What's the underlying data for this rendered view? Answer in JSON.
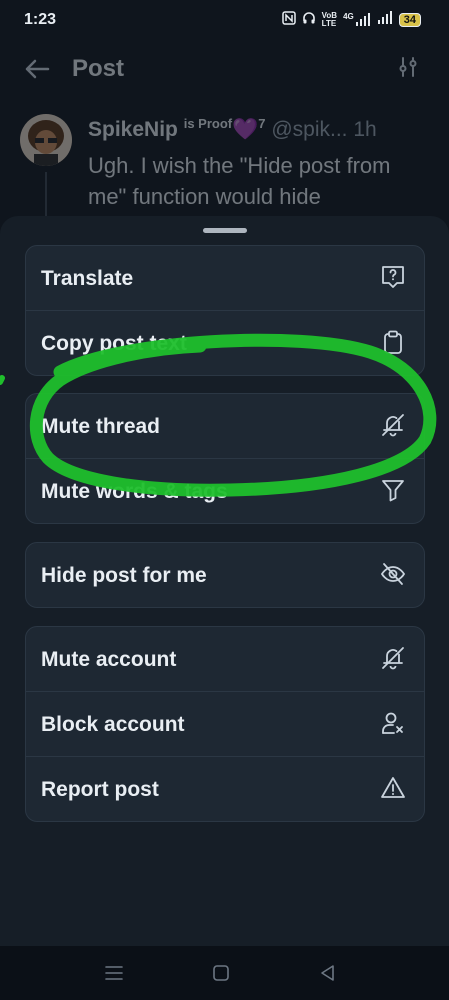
{
  "status": {
    "time": "1:23",
    "net_top": "VoB",
    "net_bottom": "LTE",
    "signal_type": "4G",
    "battery": "34"
  },
  "header": {
    "title": "Post"
  },
  "post": {
    "author": "SpikeNip",
    "author_tag": "is Proof",
    "author_emoji": "💜",
    "author_num": "7",
    "handle": "@spik...",
    "time": "1h",
    "text": "Ugh. I wish the \"Hide post from me\" function would hide"
  },
  "menu": {
    "group1": [
      {
        "label": "Translate",
        "icon": "translate-icon"
      },
      {
        "label": "Copy post text",
        "icon": "clipboard-icon"
      }
    ],
    "group2": [
      {
        "label": "Mute thread",
        "icon": "bell-off-icon"
      },
      {
        "label": "Mute words & tags",
        "icon": "filter-icon"
      }
    ],
    "group3": [
      {
        "label": "Hide post for me",
        "icon": "eye-off-icon"
      }
    ],
    "group4": [
      {
        "label": "Mute account",
        "icon": "bell-off-icon"
      },
      {
        "label": "Block account",
        "icon": "person-x-icon"
      },
      {
        "label": "Report post",
        "icon": "warning-icon"
      }
    ]
  },
  "colors": {
    "sheet_bg": "#161e27",
    "group_bg": "#1e2833",
    "annotation": "#1fbf2c"
  }
}
